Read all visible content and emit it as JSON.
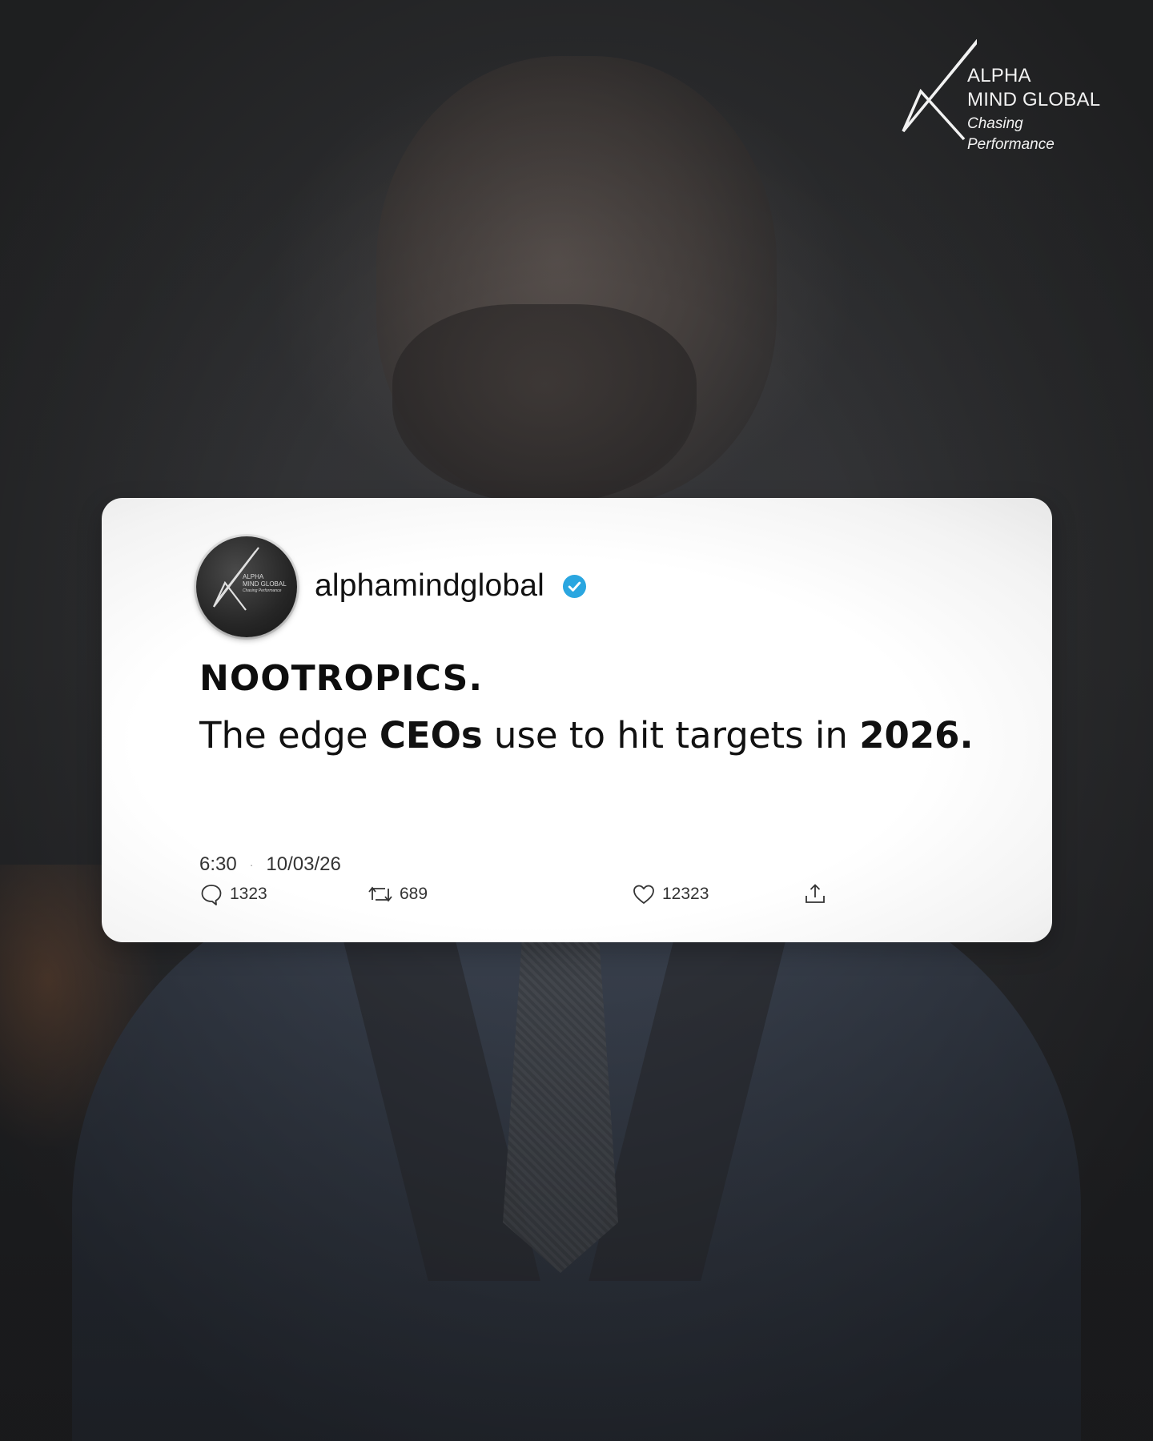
{
  "brand": {
    "line1": "ALPHA",
    "line2": "MIND GLOBAL",
    "tagline": "Chasing Performance"
  },
  "tweet": {
    "avatar": {
      "line1": "ALPHA",
      "line2": "MIND GLOBAL",
      "tagline": "Chasing Performance"
    },
    "handle": "alphamindglobal",
    "verified_icon": "verified-check-icon",
    "headline": "NOOTROPICS.",
    "body": {
      "part1": "The edge ",
      "bold1": "CEOs",
      "part2": " use to hit targets in ",
      "bold2": "2026."
    },
    "time": "6:30",
    "separator": "·",
    "date": "10/03/26",
    "stats": {
      "replies": "1323",
      "retweets": "689",
      "likes": "12323"
    }
  },
  "colors": {
    "card_bg": "#ffffff",
    "verified": "#2aa6e0",
    "text": "#111111"
  }
}
